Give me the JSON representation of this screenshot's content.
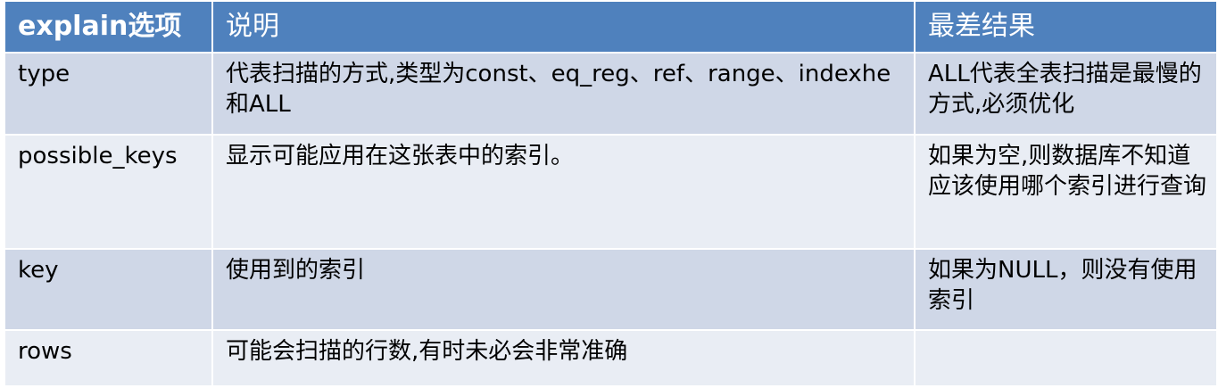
{
  "table": {
    "headers": [
      "explain选项",
      "说明",
      "最差结果"
    ],
    "rows": [
      {
        "option": "type",
        "description": "代表扫描的方式,类型为const、eq_reg、ref、range、indexhe和ALL",
        "worst": "ALL代表全表扫描是最慢的方式,必须优化"
      },
      {
        "option": "possible_keys",
        "description": "显示可能应用在这张表中的索引。",
        "worst": "如果为空,则数据库不知道应该使用哪个索引进行查询"
      },
      {
        "option": "key",
        "description": "使用到的索引",
        "worst": "如果为NULL，则没有使用索引"
      },
      {
        "option": "rows",
        "description": "可能会扫描的行数,有时未必会非常准确",
        "worst": ""
      }
    ]
  },
  "colors": {
    "header_bg": "#4f81bd",
    "row_odd_bg": "#cfd7e7",
    "row_even_bg": "#e9edf4"
  }
}
